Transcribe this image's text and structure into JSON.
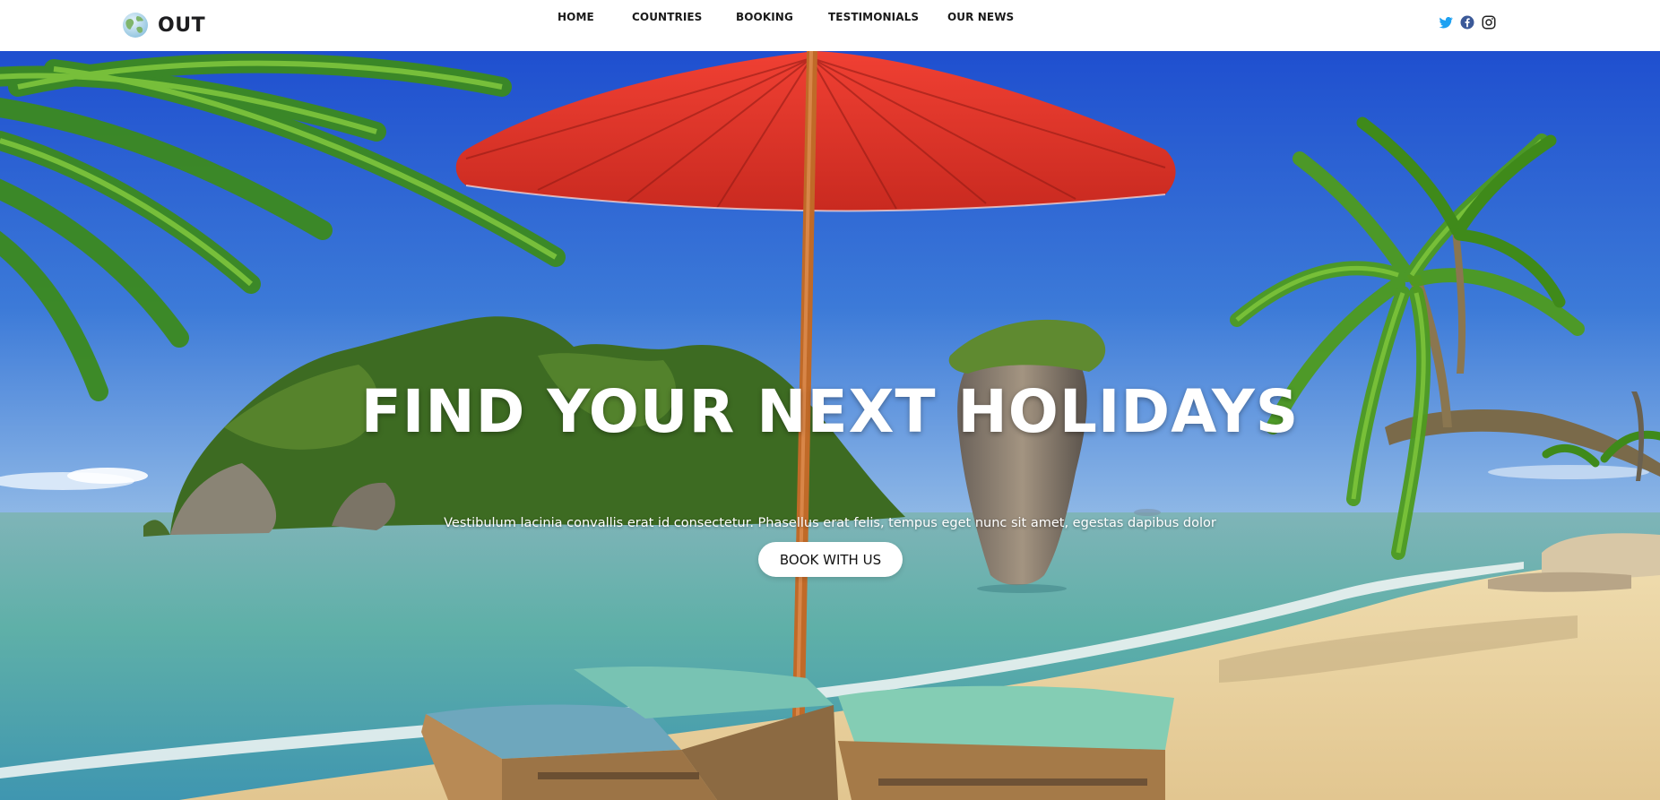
{
  "brand": {
    "name": "OUT",
    "logo_icon": "globe-icon"
  },
  "nav": {
    "items": [
      {
        "label": "HOME"
      },
      {
        "label": "COUNTRIES"
      },
      {
        "label": "BOOKING"
      },
      {
        "label": "TESTIMONIALS"
      },
      {
        "label": "OUR NEWS"
      }
    ]
  },
  "social": {
    "icons": [
      "twitter-icon",
      "facebook-icon",
      "instagram-icon"
    ],
    "colors": {
      "twitter": "#1da1f2",
      "facebook": "#3b5998",
      "instagram": "#222222"
    }
  },
  "hero": {
    "title": "FIND YOUR NEXT HOLIDAYS",
    "subtitle": "Vestibulum lacinia convallis erat id consectetur. Phasellus erat felis, tempus eget nunc sit amet, egestas dapibus dolor",
    "cta_label": "BOOK WITH US",
    "image": "tropical-beach-photo"
  },
  "colors": {
    "header_bg": "#ffffff",
    "hero_text": "#ffffff",
    "cta_bg": "#ffffff",
    "cta_text": "#111111",
    "umbrella": "#e3362b",
    "sky": "#2e63d0",
    "sea": "#4fb0ad",
    "sand": "#ecd8a8"
  }
}
